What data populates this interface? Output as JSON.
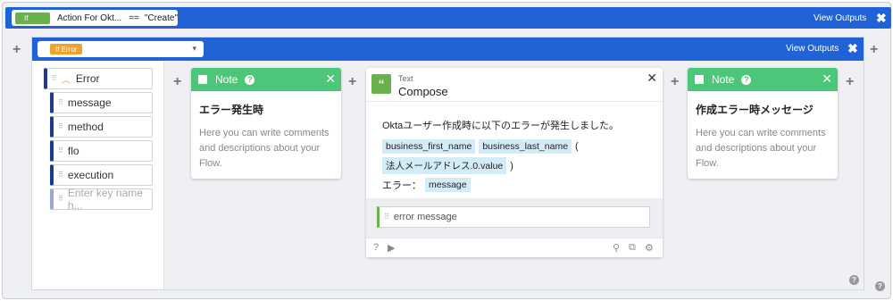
{
  "if_bar": {
    "badge": "If",
    "condition_left": "Action For Okt...",
    "operator": "==",
    "condition_right": "\"Create\"",
    "view_outputs": "View Outputs",
    "close": "✖"
  },
  "if_error": {
    "badge": "If Error",
    "view_outputs": "View Outputs",
    "close": "✖"
  },
  "keys": {
    "parent": "Error",
    "items": [
      "message",
      "method",
      "flo",
      "execution"
    ],
    "placeholder": "Enter key name h..."
  },
  "note1": {
    "header": "Note",
    "title": "エラー発生時",
    "body": "Here you can write comments and descriptions about your Flow."
  },
  "compose": {
    "type": "Text",
    "title": "Compose",
    "line1": "Oktaユーザー作成時に以下のエラーが発生しました。",
    "token_first": "business_first_name",
    "token_last": "business_last_name",
    "paren_open": "(",
    "token_email": "法人メールアドレス.0.value",
    "paren_close": ")",
    "label_error": "エラー：",
    "token_message": "message",
    "input_label": "error message"
  },
  "note2": {
    "header": "Note",
    "title": "作成エラー時メッセージ",
    "body": "Here you can write comments and descriptions about your Flow."
  },
  "colors": {
    "blue_bar": "#1f63d6",
    "note_green": "#4cc77a",
    "if_badge": "#6ab04c",
    "error_badge": "#f0a22e",
    "token_bg": "#d4ecf7"
  }
}
